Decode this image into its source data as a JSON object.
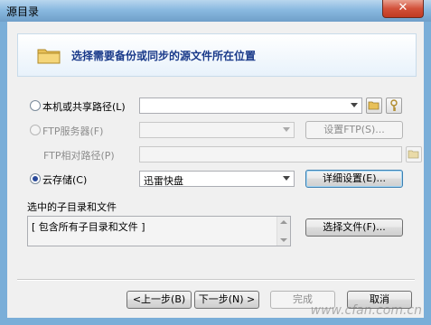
{
  "window": {
    "title": "源目录",
    "close_glyph": "✕"
  },
  "header": {
    "text": "选择需要备份或同步的源文件所在位置",
    "icon": "folder-icon"
  },
  "local": {
    "label": "本机或共享路径(L)",
    "value": "",
    "selected": false
  },
  "ftp": {
    "label": "FTP服务器(F)",
    "value": "",
    "setup_label": "设置FTP(S)...",
    "relpath_label": "FTP相对路径(P)",
    "relpath_value": "",
    "enabled": false
  },
  "cloud": {
    "label": "云存储(C)",
    "selected_option": "迅雷快盘",
    "details_label": "详细设置(E)...",
    "selected": true
  },
  "subdirs": {
    "label": "选中的子目录和文件",
    "content": "[ 包含所有子目录和文件 ]",
    "select_label": "选择文件(F)..."
  },
  "footer": {
    "prev_label": "<上一步(B)",
    "next_label": "下一步(N) >",
    "finish_label": "完成",
    "cancel_label": "取消"
  },
  "watermark": "www.cfan.com.cn",
  "colors": {
    "header_text": "#1a3a8a",
    "title_gradient": "#8ab9e0",
    "close_button": "#c03a22"
  }
}
